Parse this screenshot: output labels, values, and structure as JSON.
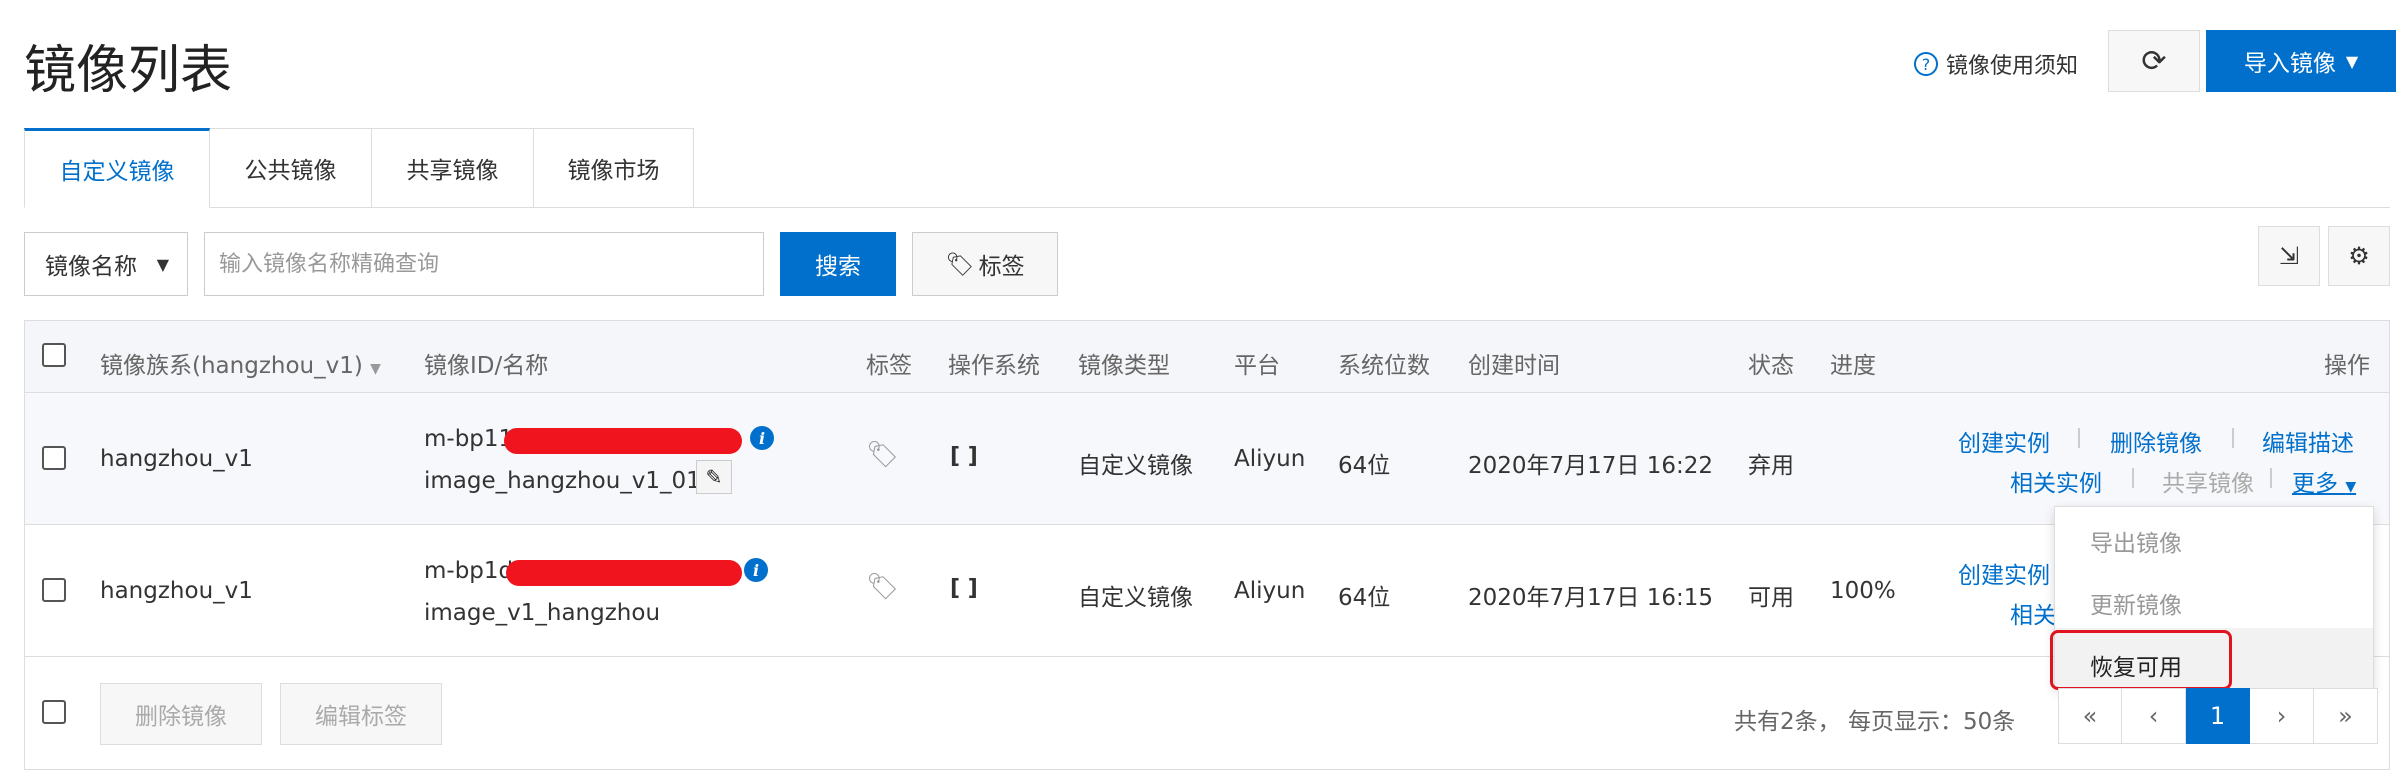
{
  "page_title": "镜像列表",
  "header": {
    "help_label": "镜像使用须知",
    "import_label": "导入镜像"
  },
  "tabs": [
    {
      "label": "自定义镜像",
      "active": true
    },
    {
      "label": "公共镜像"
    },
    {
      "label": "共享镜像"
    },
    {
      "label": "镜像市场"
    }
  ],
  "search": {
    "field_select": "镜像名称",
    "placeholder": "输入镜像名称精确查询",
    "search_label": "搜索",
    "tag_label": "标签"
  },
  "table": {
    "columns": {
      "family": "镜像族系(hangzhou_v1)",
      "id_name": "镜像ID/名称",
      "tag": "标签",
      "os": "操作系统",
      "type": "镜像类型",
      "platform": "平台",
      "bits": "系统位数",
      "created": "创建时间",
      "status": "状态",
      "progress": "进度",
      "actions": "操作"
    },
    "rows": [
      {
        "family": "hangzhou_v1",
        "id_prefix": "m-bp11",
        "name": "image_hangzhou_v1_01",
        "type": "自定义镜像",
        "platform": "Aliyun",
        "bits": "64位",
        "created": "2020年7月17日 16:22",
        "status": "弃用",
        "progress": "",
        "actions": {
          "create": "创建实例",
          "delete": "删除镜像",
          "edit_desc": "编辑描述",
          "related": "相关实例",
          "share": "共享镜像",
          "more": "更多"
        }
      },
      {
        "family": "hangzhou_v1",
        "id_prefix": "m-bp1d",
        "name": "image_v1_hangzhou",
        "type": "自定义镜像",
        "platform": "Aliyun",
        "bits": "64位",
        "created": "2020年7月17日 16:15",
        "status": "可用",
        "progress": "100%",
        "actions": {
          "create": "创建实例",
          "related": "相关"
        }
      }
    ]
  },
  "more_menu": {
    "items": [
      "导出镜像",
      "更新镜像",
      "恢复可用"
    ]
  },
  "footer": {
    "delete_label": "删除镜像",
    "edit_tag_label": "编辑标签",
    "summary": "共有2条， 每页显示：50条",
    "pager": [
      "«",
      "‹",
      "1",
      "›",
      "»"
    ]
  },
  "colors": {
    "primary": "#0070cc",
    "highlight": "#e0141e"
  }
}
